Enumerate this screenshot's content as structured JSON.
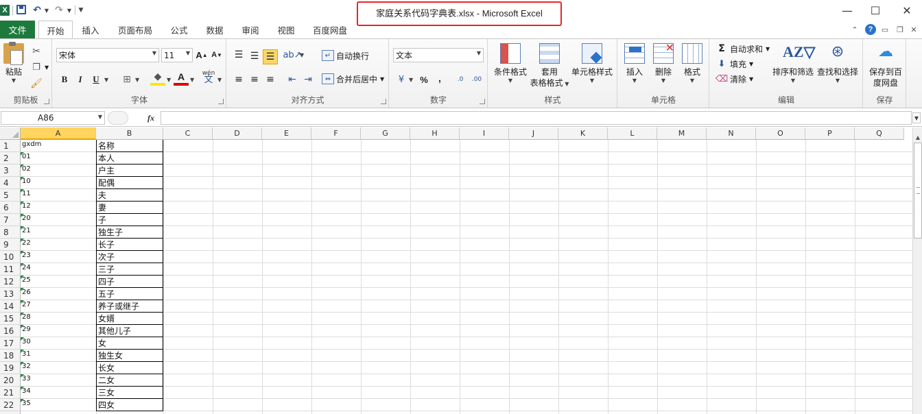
{
  "window": {
    "title": "家庭关系代码字典表.xlsx  -  Microsoft Excel",
    "app_logo": "X",
    "quick_access": [
      "save-icon",
      "undo-icon",
      "redo-icon",
      "customize-icon"
    ],
    "controls": {
      "minimize": "—",
      "maximize": "☐",
      "close": "✕"
    }
  },
  "tabs": {
    "file": "文件",
    "items": [
      "开始",
      "插入",
      "页面布局",
      "公式",
      "数据",
      "审阅",
      "视图",
      "百度网盘"
    ],
    "active": "开始"
  },
  "ribbon": {
    "clipboard": {
      "paste": "粘贴",
      "label": "剪贴板"
    },
    "font": {
      "font_name": "宋体",
      "font_size": "11",
      "bold": "B",
      "italic": "I",
      "underline": "U",
      "grow": "A",
      "shrink": "A",
      "wen": "wén",
      "label": "字体"
    },
    "alignment": {
      "wrap": "自动换行",
      "merge": "合并后居中",
      "label": "对齐方式"
    },
    "number": {
      "format": "文本",
      "percent": "%",
      "comma": ",",
      "inc_dec": ".0",
      "dec_dec": ".00",
      "label": "数字"
    },
    "styles": {
      "conditional": "条件格式",
      "table_1": "套用",
      "table_2": "表格格式",
      "cell_styles": "单元格样式",
      "label": "样式"
    },
    "cells": {
      "insert": "插入",
      "delete": "删除",
      "format": "格式",
      "label": "单元格"
    },
    "editing": {
      "autosum": "自动求和",
      "fill": "填充",
      "clear": "清除",
      "sort": "排序和筛选",
      "find": "查找和选择",
      "label": "编辑",
      "sigma": "Σ"
    },
    "save": {
      "save_1": "保存到百",
      "save_2": "度网盘",
      "label": "保存"
    }
  },
  "formula_bar": {
    "name_box": "A86",
    "fx": "fx",
    "formula": ""
  },
  "sheet": {
    "columns": [
      "A",
      "B",
      "C",
      "D",
      "E",
      "F",
      "G",
      "H",
      "I",
      "J",
      "K",
      "L",
      "M",
      "N",
      "O",
      "P",
      "Q"
    ],
    "selected_column": "A",
    "rows": [
      {
        "n": "1",
        "a": "gxdm",
        "b": "名称"
      },
      {
        "n": "2",
        "a": "01",
        "b": "本人"
      },
      {
        "n": "3",
        "a": "02",
        "b": "户主"
      },
      {
        "n": "4",
        "a": "10",
        "b": "配偶"
      },
      {
        "n": "5",
        "a": "11",
        "b": "夫"
      },
      {
        "n": "6",
        "a": "12",
        "b": "妻"
      },
      {
        "n": "7",
        "a": "20",
        "b": "子"
      },
      {
        "n": "8",
        "a": "21",
        "b": "独生子"
      },
      {
        "n": "9",
        "a": "22",
        "b": "长子"
      },
      {
        "n": "10",
        "a": "23",
        "b": "次子"
      },
      {
        "n": "11",
        "a": "24",
        "b": "三子"
      },
      {
        "n": "12",
        "a": "25",
        "b": "四子"
      },
      {
        "n": "13",
        "a": "26",
        "b": "五子"
      },
      {
        "n": "14",
        "a": "27",
        "b": "养子或继子"
      },
      {
        "n": "15",
        "a": "28",
        "b": "女婿"
      },
      {
        "n": "16",
        "a": "29",
        "b": "其他儿子"
      },
      {
        "n": "17",
        "a": "30",
        "b": "女"
      },
      {
        "n": "18",
        "a": "31",
        "b": "独生女"
      },
      {
        "n": "19",
        "a": "32",
        "b": "长女"
      },
      {
        "n": "20",
        "a": "33",
        "b": "二女"
      },
      {
        "n": "21",
        "a": "34",
        "b": "三女"
      },
      {
        "n": "22",
        "a": "35",
        "b": "四女"
      }
    ]
  },
  "colors": {
    "accent": "#1e7a3c",
    "selection": "#ffd560",
    "title_highlight": "#e3262a"
  }
}
